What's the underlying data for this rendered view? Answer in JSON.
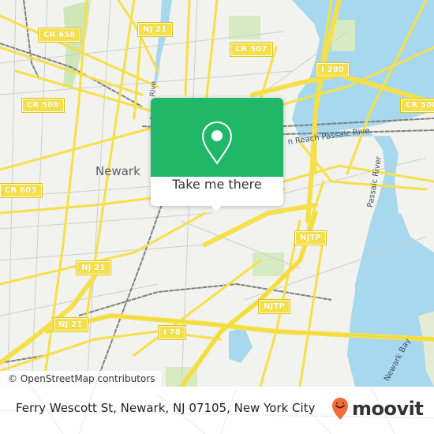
{
  "map": {
    "colors": {
      "land": "#f2f2ee",
      "water": "#a8d8ee",
      "park": "#cfe6b8",
      "road_major": "#f6e04a",
      "road_minor": "#c9c9c4",
      "rail": "#808080"
    },
    "place_labels": [
      {
        "name": "newark-label",
        "text": "Newark"
      }
    ],
    "road_shields": [
      {
        "id": "cr658",
        "text": "CR 658"
      },
      {
        "id": "nj21-top",
        "text": "NJ 21"
      },
      {
        "id": "cr507",
        "text": "CR 507"
      },
      {
        "id": "i280",
        "text": "I 280"
      },
      {
        "id": "cr508-left",
        "text": "CR 508"
      },
      {
        "id": "cr508-right",
        "text": "CR 508"
      },
      {
        "id": "cr603",
        "text": "CR 603"
      },
      {
        "id": "njtp-upper",
        "text": "NJTP"
      },
      {
        "id": "nj21-mid",
        "text": "NJ 21"
      },
      {
        "id": "njtp-lower",
        "text": "NJTP"
      },
      {
        "id": "nj21-low",
        "text": "NJ 21"
      },
      {
        "id": "i78",
        "text": "I 78"
      }
    ],
    "water_labels": [
      {
        "id": "passaic-reach",
        "text": "n Reach Passaic Rive"
      },
      {
        "id": "passaic-river",
        "text": "Passaic River"
      },
      {
        "id": "passaic-small",
        "text": "Rive"
      },
      {
        "id": "newark-bay",
        "text": "Newark Bay"
      }
    ],
    "attribution": "© OpenStreetMap contributors"
  },
  "popup": {
    "icon": "location-pin-icon",
    "button_label": "Take me there",
    "accent": "#20b768"
  },
  "footer": {
    "address": "Ferry Wescott St, Newark, NJ 07105, New York City",
    "brand": "moovit",
    "brand_color": "#f26b3a"
  }
}
